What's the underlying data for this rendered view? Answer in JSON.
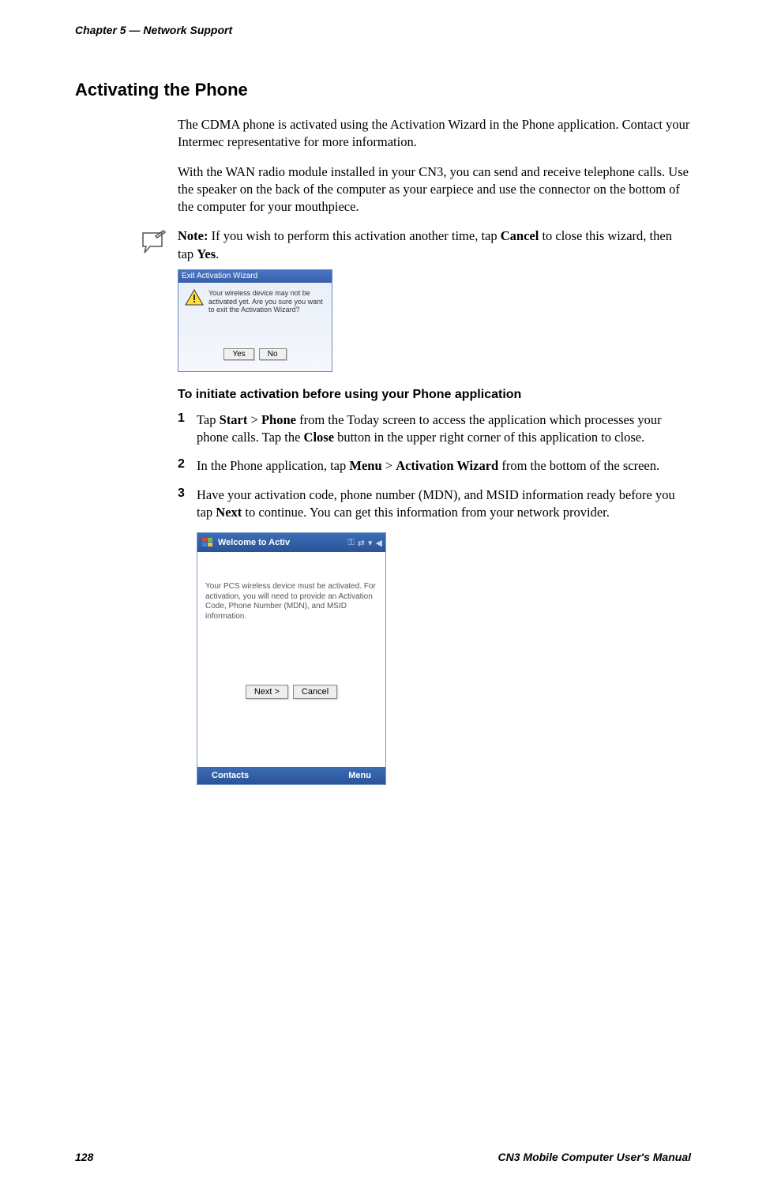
{
  "header": {
    "chapter": "Chapter 5 — Network Support"
  },
  "section_title": "Activating the Phone",
  "para1": "The CDMA phone is activated using the Activation Wizard in the Phone application. Contact your Intermec representative for more information.",
  "para2": "With the WAN radio module installed in your CN3, you can send and receive telephone calls. Use the speaker on the back of the computer as your earpiece and use the connector on the bottom of the computer for your mouthpiece.",
  "note": {
    "label": "Note:",
    "text_part1": " If you wish to perform this activation another time, tap ",
    "bold1": "Cancel",
    "text_part2": " to close this wizard, then tap ",
    "bold2": "Yes",
    "text_part3": "."
  },
  "dialog": {
    "title": "Exit Activation Wizard",
    "message": "Your wireless device may not be activated yet.  Are you sure you want to exit the Activation Wizard?",
    "yes": "Yes",
    "no": "No"
  },
  "sub_heading": "To initiate activation before using your Phone application",
  "steps": [
    {
      "num": "1",
      "pre": "Tap ",
      "b1": "Start",
      "mid1": " > ",
      "b2": "Phone",
      "mid2": " from the Today screen to access the application which processes your phone calls. Tap the ",
      "b3": "Close",
      "post": " button in the upper right corner of this application to close."
    },
    {
      "num": "2",
      "pre": "In the Phone application, tap ",
      "b1": "Menu",
      "mid1": " > ",
      "b2": "Activation Wizard",
      "post": " from the bottom of the screen."
    },
    {
      "num": "3",
      "pre": "Have your activation code, phone number (MDN), and MSID information ready before you tap ",
      "b1": "Next",
      "post": " to continue. You can get this information from your network provider."
    }
  ],
  "phone": {
    "title": "Welcome to Activ",
    "body": "Your PCS wireless device must be activated. For activation, you will need to provide an Activation Code, Phone Number (MDN), and MSID information.",
    "next": "Next >",
    "cancel": "Cancel",
    "left_soft": "Contacts",
    "right_soft": "Menu"
  },
  "footer": {
    "page": "128",
    "manual": "CN3 Mobile Computer User's Manual"
  }
}
